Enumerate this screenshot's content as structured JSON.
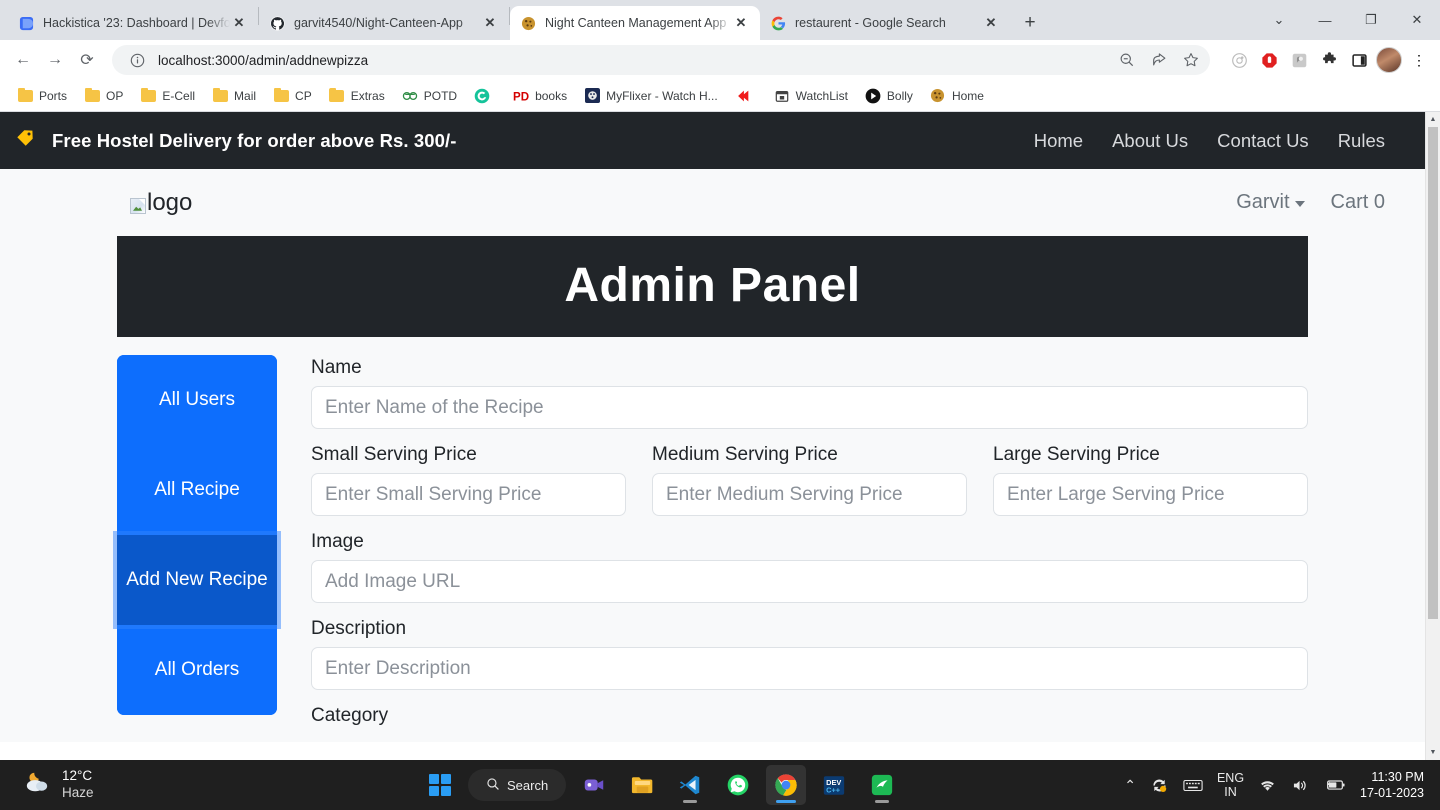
{
  "browser": {
    "tabs": [
      {
        "title": "Hackistica '23: Dashboard | Devfo",
        "favicon": "blue-doc-icon",
        "active": false,
        "close_label": "✕"
      },
      {
        "title": "garvit4540/Night-Canteen-App",
        "favicon": "github-icon",
        "active": false,
        "close_label": "✕"
      },
      {
        "title": "Night Canteen Management App",
        "favicon": "cookie-icon",
        "active": true,
        "close_label": "✕"
      },
      {
        "title": "restaurent - Google Search",
        "favicon": "google-icon",
        "active": false,
        "close_label": "✕"
      }
    ],
    "new_tab_label": "+",
    "window_controls": [
      "⌄",
      "—",
      "❐",
      "✕"
    ],
    "nav": {
      "back": "←",
      "forward": "→",
      "reload": "⟳"
    },
    "omnibox": {
      "site_info_icon": "info-circle-icon",
      "url": "localhost:3000/admin/addnewpizza",
      "zoom_icon": "zoom-out-icon",
      "share_icon": "share-icon",
      "bookmark_icon": "star-icon"
    },
    "extensions": [
      "adblock-detector-icon",
      "adblock-icon",
      "grayscale-extension-icon",
      "puzzle-icon",
      "sidepanel-icon"
    ],
    "profile": "profile-avatar",
    "menu": "⋮",
    "bookmarks": [
      {
        "label": "Ports",
        "icon": "folder"
      },
      {
        "label": "OP",
        "icon": "folder"
      },
      {
        "label": "E-Cell",
        "icon": "folder"
      },
      {
        "label": "Mail",
        "icon": "folder"
      },
      {
        "label": "CP",
        "icon": "folder"
      },
      {
        "label": "Extras",
        "icon": "folder"
      },
      {
        "label": "POTD",
        "icon": "geeksforgeeks"
      },
      {
        "label": "",
        "icon": "grammarly"
      },
      {
        "label": "books",
        "icon": "pd"
      },
      {
        "label": "MyFlixer - Watch H...",
        "icon": "myflixer"
      },
      {
        "label": "",
        "icon": "red-arrow"
      },
      {
        "label": "WatchList",
        "icon": "calendar"
      },
      {
        "label": "Bolly",
        "icon": "play"
      },
      {
        "label": "Home",
        "icon": "cookie"
      }
    ]
  },
  "page": {
    "promo": {
      "icon": "price-tag-icon",
      "text": "Free Hostel Delivery for order above Rs. 300/-",
      "nav": [
        "Home",
        "About Us",
        "Contact Us",
        "Rules"
      ]
    },
    "navbar": {
      "logo_alt": "logo",
      "user_name": "Garvit",
      "cart_label": "Cart 0"
    },
    "admin_title": "Admin Panel",
    "sidebar": [
      {
        "label": "All Users",
        "active": false
      },
      {
        "label": "All Recipe",
        "active": false
      },
      {
        "label": "Add New Recipe",
        "active": true
      },
      {
        "label": "All Orders",
        "active": false
      }
    ],
    "form": {
      "name": {
        "label": "Name",
        "placeholder": "Enter Name of the Recipe",
        "value": ""
      },
      "small_price": {
        "label": "Small Serving Price",
        "placeholder": "Enter Small Serving Price",
        "value": ""
      },
      "medium_price": {
        "label": "Medium Serving Price",
        "placeholder": "Enter Medium Serving Price",
        "value": ""
      },
      "large_price": {
        "label": "Large Serving Price",
        "placeholder": "Enter Large Serving Price",
        "value": ""
      },
      "image": {
        "label": "Image",
        "placeholder": "Add Image URL",
        "value": ""
      },
      "description": {
        "label": "Description",
        "placeholder": "Enter Description",
        "value": ""
      },
      "category": {
        "label": "Category"
      }
    },
    "colors": {
      "primary": "#0d6efd",
      "primary_active": "#0a58ca",
      "dark": "#212529",
      "accent_yellow": "#ffc107",
      "page_bg": "#f8f9fa"
    }
  },
  "taskbar": {
    "weather": {
      "icon": "haze-moon-icon",
      "temperature": "12°C",
      "condition": "Haze"
    },
    "start_label": "start-button",
    "search_label": "Search",
    "apps": [
      {
        "name": "teams-icon",
        "state": "idle"
      },
      {
        "name": "file-explorer-icon",
        "state": "idle"
      },
      {
        "name": "vscode-icon",
        "state": "running"
      },
      {
        "name": "whatsapp-icon",
        "state": "idle"
      },
      {
        "name": "chrome-icon",
        "state": "active"
      },
      {
        "name": "devcpp-icon",
        "state": "idle"
      },
      {
        "name": "green-app-icon",
        "state": "running"
      }
    ],
    "tray": {
      "overflow": "⌃",
      "onedrive_sync": "sync-icon",
      "keyboard": "keyboard-icon",
      "language": "ENG",
      "language_sub": "IN",
      "wifi": "wifi-icon",
      "volume": "volume-icon",
      "battery": "battery-charging-icon",
      "time": "11:30 PM",
      "date": "17-01-2023"
    }
  }
}
